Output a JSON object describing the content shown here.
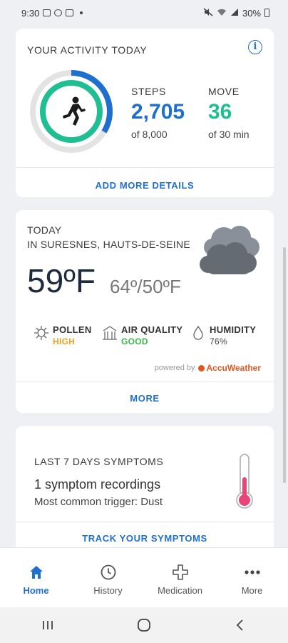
{
  "status_bar": {
    "time": "9:30",
    "battery": "30%"
  },
  "activity": {
    "title": "YOUR ACTIVITY TODAY",
    "steps_label": "STEPS",
    "steps_value": "2,705",
    "steps_goal": "of 8,000",
    "steps_progress": 0.338,
    "move_label": "MOVE",
    "move_value": "36",
    "move_goal": "of 30 min",
    "move_progress": 1.0,
    "add_details": "ADD MORE DETAILS"
  },
  "weather": {
    "today": "TODAY",
    "location": "IN SURESNES, HAUTS-DE-SEINE",
    "temp": "59ºF",
    "range": "64º/50ºF",
    "pollen_label": "POLLEN",
    "pollen_value": "HIGH",
    "air_label": "AIR QUALITY",
    "air_value": "GOOD",
    "humidity_label": "HUMIDITY",
    "humidity_value": "76%",
    "powered_by": "powered by",
    "provider": "AccuWeather",
    "more": "MORE"
  },
  "symptoms": {
    "title": "LAST 7 DAYS SYMPTOMS",
    "recordings": "1 symptom recordings",
    "trigger": "Most common trigger: Dust",
    "track": "TRACK YOUR SYMPTOMS"
  },
  "bottom_nav": [
    {
      "label": "Home",
      "icon": "home-icon",
      "active": true
    },
    {
      "label": "History",
      "icon": "clock-icon",
      "active": false
    },
    {
      "label": "Medication",
      "icon": "cross-icon",
      "active": false
    },
    {
      "label": "More",
      "icon": "dots-icon",
      "active": false
    }
  ],
  "colors": {
    "accent_blue": "#1f6fcf",
    "accent_green": "#1fbf93",
    "pollen_orange": "#f0a020",
    "air_green": "#3cb84a"
  }
}
